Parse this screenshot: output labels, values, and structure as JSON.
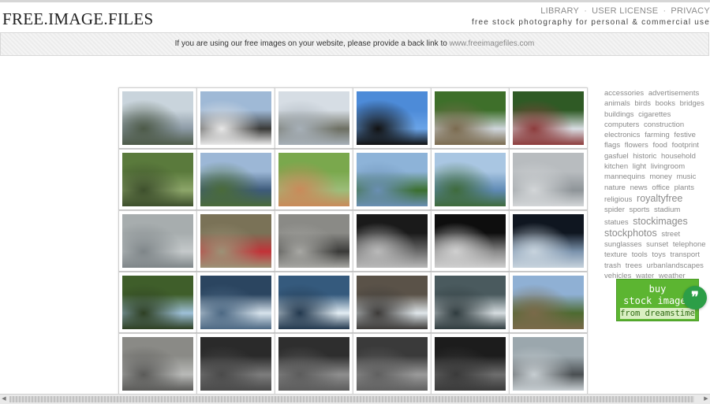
{
  "header": {
    "logo": "FREE.IMAGE.FILES",
    "nav": [
      "LIBRARY",
      "USER LICENSE",
      "PRIVACY"
    ],
    "nav_separator": "·",
    "tagline": "free stock photography for personal & commercial use"
  },
  "notice": {
    "text": "If you are using our free images on your website, please provide a back link to ",
    "link": "www.freeimagefiles.com"
  },
  "thumbnails": [
    {
      "name": "snowy-pond",
      "colors": [
        "#c9d4dc",
        "#8c9aa5",
        "#4d5a48"
      ]
    },
    {
      "name": "snowy-creek",
      "colors": [
        "#9fb9d6",
        "#3a3a38",
        "#e8e8e8"
      ]
    },
    {
      "name": "snowy-forest",
      "colors": [
        "#d6dde4",
        "#6d6f62",
        "#a7b0b8"
      ]
    },
    {
      "name": "weather-vane",
      "colors": [
        "#4d8bd8",
        "#6aa4e8",
        "#111111"
      ]
    },
    {
      "name": "waterfall-rainbow",
      "colors": [
        "#3e6f2a",
        "#cfd6dc",
        "#7a6a4e"
      ]
    },
    {
      "name": "waterfall-rocks",
      "colors": [
        "#2f5a25",
        "#d8dde3",
        "#8c3b3b"
      ]
    },
    {
      "name": "jungle-pond",
      "colors": [
        "#5a7a3c",
        "#8da66a",
        "#3d4f2c"
      ]
    },
    {
      "name": "lake-view",
      "colors": [
        "#9cb7d6",
        "#3d5a7a",
        "#4a6b3a"
      ]
    },
    {
      "name": "green-pool",
      "colors": [
        "#7aa84d",
        "#9dbd7a",
        "#c98a5a"
      ]
    },
    {
      "name": "island-lake",
      "colors": [
        "#8db3d8",
        "#3b6f2f",
        "#6a8fb3"
      ]
    },
    {
      "name": "blue-bay",
      "colors": [
        "#a9c6e2",
        "#5f8ab5",
        "#3f6b3c"
      ]
    },
    {
      "name": "grey-water",
      "colors": [
        "#b8bcbf",
        "#8e9498",
        "#d3d6d8"
      ]
    },
    {
      "name": "choppy-water",
      "colors": [
        "#a7adae",
        "#c4c9ca",
        "#7e8588"
      ]
    },
    {
      "name": "red-hose-nozzle",
      "colors": [
        "#7a7257",
        "#c23238",
        "#9c9276"
      ]
    },
    {
      "name": "valve-wheel",
      "colors": [
        "#8a8a86",
        "#3a3a38",
        "#a8a8a4"
      ]
    },
    {
      "name": "metal-rail",
      "colors": [
        "#1a1a1a",
        "#6c6c6c",
        "#b9b9b9"
      ]
    },
    {
      "name": "metal-pipe",
      "colors": [
        "#0e0e0e",
        "#8a8a8a",
        "#cfcfcf"
      ]
    },
    {
      "name": "framed-window",
      "colors": [
        "#0f1620",
        "#7b93ad",
        "#c7d3dd"
      ]
    },
    {
      "name": "river-trees",
      "colors": [
        "#3f5e2a",
        "#9ec0d8",
        "#2d3f22"
      ]
    },
    {
      "name": "waves-rock-1",
      "colors": [
        "#2b4560",
        "#d7e3ec",
        "#4c6883"
      ]
    },
    {
      "name": "waves-rock-2",
      "colors": [
        "#355a7d",
        "#e3edf3",
        "#22384e"
      ]
    },
    {
      "name": "wave-shore",
      "colors": [
        "#5a5248",
        "#dfe6ea",
        "#3c3a38"
      ]
    },
    {
      "name": "rapids",
      "colors": [
        "#4a5a5e",
        "#d5dcdf",
        "#2f3b3e"
      ]
    },
    {
      "name": "fallen-tree",
      "colors": [
        "#8fb0d4",
        "#4d6b31",
        "#7a6a4a"
      ]
    },
    {
      "name": "silver-car",
      "colors": [
        "#8a8a86",
        "#b9bab8",
        "#5a5a58"
      ]
    },
    {
      "name": "car-vent",
      "colors": [
        "#2a2a2a",
        "#7d7d7d",
        "#4a4a4a"
      ]
    },
    {
      "name": "gear-shift-1",
      "colors": [
        "#2e2e2e",
        "#8e8e8e",
        "#5c5c5c"
      ]
    },
    {
      "name": "gear-shift-2",
      "colors": [
        "#3a3a3a",
        "#9a9a9a",
        "#606060"
      ]
    },
    {
      "name": "steering-wheel",
      "colors": [
        "#1c1c1c",
        "#6e6e6e",
        "#3a3a3a"
      ]
    },
    {
      "name": "car-interior",
      "colors": [
        "#9ba7ad",
        "#4a4f52",
        "#c7ced2"
      ]
    }
  ],
  "tags": [
    {
      "label": "accessories",
      "big": false
    },
    {
      "label": "advertisements",
      "big": false
    },
    {
      "label": "animals",
      "big": false
    },
    {
      "label": "birds",
      "big": false
    },
    {
      "label": "books",
      "big": false
    },
    {
      "label": "bridges",
      "big": false
    },
    {
      "label": "buildings",
      "big": false
    },
    {
      "label": "cigarettes",
      "big": false
    },
    {
      "label": "computers",
      "big": false
    },
    {
      "label": "construction",
      "big": false
    },
    {
      "label": "electronics",
      "big": false
    },
    {
      "label": "farming",
      "big": false
    },
    {
      "label": "festive",
      "big": false
    },
    {
      "label": "flags",
      "big": false
    },
    {
      "label": "flowers",
      "big": false
    },
    {
      "label": "food",
      "big": false
    },
    {
      "label": "footprint",
      "big": false
    },
    {
      "label": "gasfuel",
      "big": false
    },
    {
      "label": "historic",
      "big": false
    },
    {
      "label": "household",
      "big": false
    },
    {
      "label": "kitchen",
      "big": false
    },
    {
      "label": "light",
      "big": false
    },
    {
      "label": "livingroom",
      "big": false
    },
    {
      "label": "mannequins",
      "big": false
    },
    {
      "label": "money",
      "big": false
    },
    {
      "label": "music",
      "big": false
    },
    {
      "label": "nature",
      "big": false
    },
    {
      "label": "news",
      "big": false
    },
    {
      "label": "office",
      "big": false
    },
    {
      "label": "plants",
      "big": false
    },
    {
      "label": "religious",
      "big": false
    },
    {
      "label": "royaltyfree",
      "big": true
    },
    {
      "label": "spider",
      "big": false
    },
    {
      "label": "sports",
      "big": false
    },
    {
      "label": "stadium",
      "big": false
    },
    {
      "label": "statues",
      "big": false
    },
    {
      "label": "stockimages",
      "big": true
    },
    {
      "label": "stockphotos",
      "big": true
    },
    {
      "label": "street",
      "big": false
    },
    {
      "label": "sunglasses",
      "big": false
    },
    {
      "label": "sunset",
      "big": false
    },
    {
      "label": "telephone",
      "big": false
    },
    {
      "label": "texture",
      "big": false
    },
    {
      "label": "tools",
      "big": false
    },
    {
      "label": "toys",
      "big": false
    },
    {
      "label": "transport",
      "big": false
    },
    {
      "label": "trash",
      "big": false
    },
    {
      "label": "trees",
      "big": false
    },
    {
      "label": "urbanlandscapes",
      "big": false
    },
    {
      "label": "vehicles",
      "big": false
    },
    {
      "label": "water",
      "big": false
    },
    {
      "label": "weather",
      "big": false
    }
  ],
  "ad": {
    "line1": "buy",
    "line2": "stock images",
    "line3": "from dreamstime",
    "badge": "❞",
    "bg_color": "#5cb531",
    "badge_color": "#2c9e47"
  }
}
